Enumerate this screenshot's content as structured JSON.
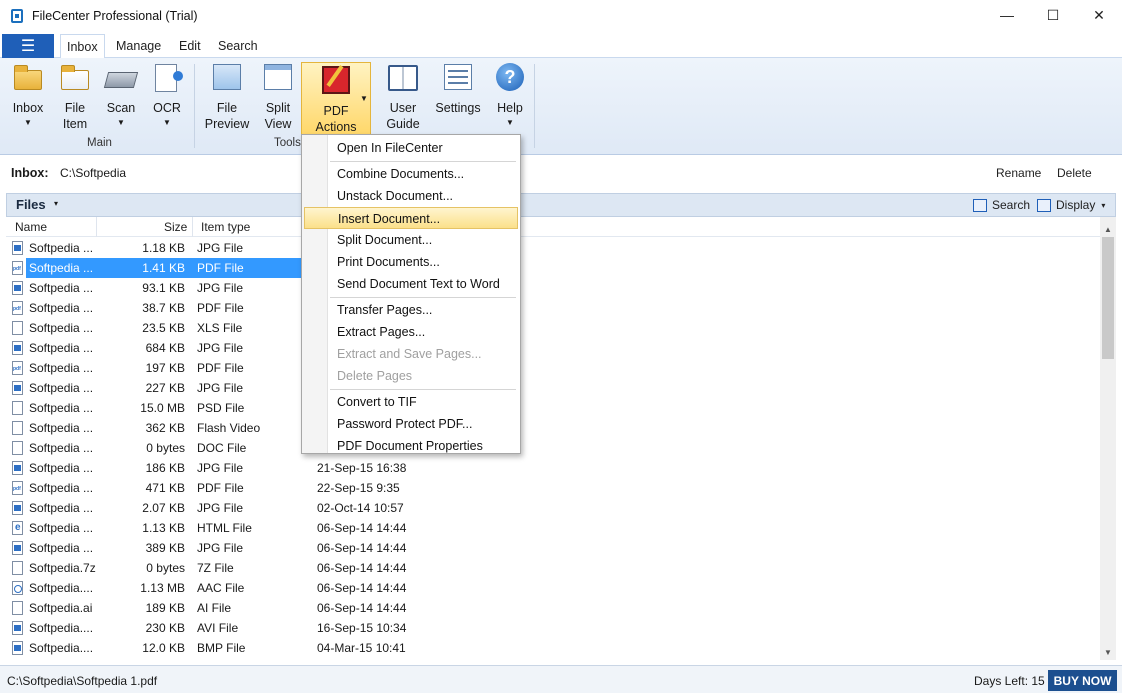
{
  "window": {
    "title": "FileCenter Professional (Trial)",
    "minimize": "—",
    "maximize": "☐",
    "close": "✕"
  },
  "ribbon": {
    "menu_glyph": "☰",
    "tabs": [
      "Inbox",
      "Manage",
      "Edit",
      "Search"
    ],
    "active_tab": "Inbox",
    "buttons": [
      {
        "label": "Inbox",
        "icon": "folder-icon",
        "dropdown": true
      },
      {
        "label": "File\nItem",
        "icon": "file-item-icon",
        "dropdown": false
      },
      {
        "label": "Scan",
        "icon": "scanner-icon",
        "dropdown": true
      },
      {
        "label": "OCR",
        "icon": "ocr-icon",
        "dropdown": true
      },
      {
        "label": "File\nPreview",
        "icon": "file-preview-icon",
        "dropdown": false
      },
      {
        "label": "Split\nView",
        "icon": "split-view-icon",
        "dropdown": false
      },
      {
        "label": "PDF\nActions",
        "icon": "pdf-actions-icon",
        "dropdown": true
      },
      {
        "label": "User\nGuide",
        "icon": "book-icon",
        "dropdown": false
      },
      {
        "label": "Settings",
        "icon": "settings-icon",
        "dropdown": false
      },
      {
        "label": "Help",
        "icon": "help-icon",
        "dropdown": true
      }
    ],
    "groups": [
      "Main",
      "Tools"
    ],
    "dropdown_glyph": "▼",
    "help_glyph": "?"
  },
  "path_bar": {
    "label": "Inbox:",
    "path": "C:\\Softpedia",
    "rename": "Rename",
    "delete": "Delete"
  },
  "files_panel": {
    "title": "Files",
    "dropdown_glyph": "▾",
    "search": "Search",
    "display": "Display",
    "columns": [
      "Name",
      "Size",
      "Item type"
    ]
  },
  "files": [
    {
      "name": "Softpedia ...",
      "size": "1.18 KB",
      "type": "JPG File",
      "date": "",
      "icon": "image-file-icon"
    },
    {
      "name": "Softpedia ...",
      "size": "1.41 KB",
      "type": "PDF File",
      "date": "",
      "icon": "pdf-file-icon",
      "selected": true
    },
    {
      "name": "Softpedia ...",
      "size": "93.1 KB",
      "type": "JPG File",
      "date": "",
      "icon": "image-file-icon"
    },
    {
      "name": "Softpedia ...",
      "size": "38.7 KB",
      "type": "PDF File",
      "date": "",
      "icon": "pdf-file-icon"
    },
    {
      "name": "Softpedia ...",
      "size": "23.5 KB",
      "type": "XLS File",
      "date": "",
      "icon": "blank-file-icon"
    },
    {
      "name": "Softpedia ...",
      "size": "684 KB",
      "type": "JPG File",
      "date": "",
      "icon": "image-file-icon"
    },
    {
      "name": "Softpedia ...",
      "size": "197 KB",
      "type": "PDF File",
      "date": "",
      "icon": "pdf-file-icon"
    },
    {
      "name": "Softpedia ...",
      "size": "227 KB",
      "type": "JPG File",
      "date": "",
      "icon": "image-file-icon"
    },
    {
      "name": "Softpedia ...",
      "size": "15.0 MB",
      "type": "PSD File",
      "date": "",
      "icon": "blank-file-icon"
    },
    {
      "name": "Softpedia ...",
      "size": "362 KB",
      "type": "Flash Video",
      "date": "",
      "icon": "blank-file-icon"
    },
    {
      "name": "Softpedia ...",
      "size": "0 bytes",
      "type": "DOC File",
      "date": "",
      "icon": "blank-file-icon"
    },
    {
      "name": "Softpedia ...",
      "size": "186 KB",
      "type": "JPG File",
      "date": "21-Sep-15 16:38",
      "icon": "image-file-icon"
    },
    {
      "name": "Softpedia ...",
      "size": "471 KB",
      "type": "PDF File",
      "date": "22-Sep-15 9:35",
      "icon": "pdf-file-icon"
    },
    {
      "name": "Softpedia ...",
      "size": "2.07 KB",
      "type": "JPG File",
      "date": "02-Oct-14 10:57",
      "icon": "image-file-icon"
    },
    {
      "name": "Softpedia ...",
      "size": "1.13 KB",
      "type": "HTML File",
      "date": "06-Sep-14 14:44",
      "icon": "html-file-icon"
    },
    {
      "name": "Softpedia ...",
      "size": "389 KB",
      "type": "JPG File",
      "date": "06-Sep-14 14:44",
      "icon": "image-file-icon"
    },
    {
      "name": "Softpedia.7z",
      "size": "0 bytes",
      "type": "7Z File",
      "date": "06-Sep-14 14:44",
      "icon": "blank-file-icon"
    },
    {
      "name": "Softpedia....",
      "size": "1.13 MB",
      "type": "AAC File",
      "date": "06-Sep-14 14:44",
      "icon": "audio-file-icon"
    },
    {
      "name": "Softpedia.ai",
      "size": "189 KB",
      "type": "AI File",
      "date": "06-Sep-14 14:44",
      "icon": "blank-file-icon"
    },
    {
      "name": "Softpedia....",
      "size": "230 KB",
      "type": "AVI File",
      "date": "16-Sep-15 10:34",
      "icon": "image-file-icon"
    },
    {
      "name": "Softpedia....",
      "size": "12.0 KB",
      "type": "BMP File",
      "date": "04-Mar-15 10:41",
      "icon": "image-file-icon"
    }
  ],
  "pdf_actions_menu": {
    "items": [
      {
        "label": "Open In FileCenter",
        "enabled": true
      },
      {
        "separator": true
      },
      {
        "label": "Combine Documents...",
        "enabled": true
      },
      {
        "label": "Unstack Document...",
        "enabled": true
      },
      {
        "label": "Insert Document...",
        "enabled": true,
        "highlighted": true
      },
      {
        "label": "Split Document...",
        "enabled": true
      },
      {
        "label": "Print Documents...",
        "enabled": true
      },
      {
        "label": "Send Document Text to Word",
        "enabled": true
      },
      {
        "separator": true
      },
      {
        "label": "Transfer Pages...",
        "enabled": true
      },
      {
        "label": "Extract Pages...",
        "enabled": true
      },
      {
        "label": "Extract and Save Pages...",
        "enabled": false
      },
      {
        "label": "Delete Pages",
        "enabled": false
      },
      {
        "separator": true
      },
      {
        "label": "Convert to TIF",
        "enabled": true
      },
      {
        "label": "Password Protect PDF...",
        "enabled": true
      },
      {
        "label": "PDF Document Properties",
        "enabled": true
      }
    ]
  },
  "scrollbar": {
    "up_glyph": "▲",
    "down_glyph": "▼"
  },
  "status_bar": {
    "path": "C:\\Softpedia\\Softpedia 1.pdf",
    "days_left": "Days Left: 15",
    "buy_now": "BUY NOW"
  },
  "colors": {
    "accent": "#1f5fb8",
    "selection": "#3399ff",
    "menu_highlight": "#fbe08a",
    "buy_button": "#1c4f8f"
  }
}
